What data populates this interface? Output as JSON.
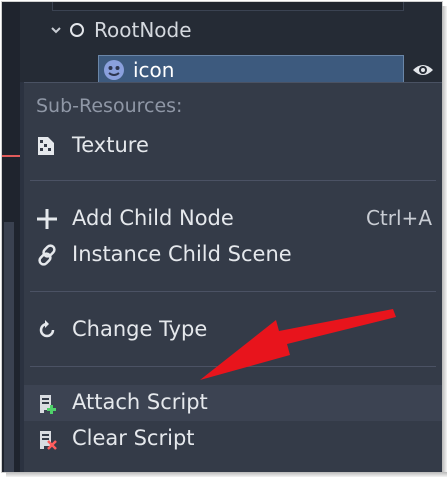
{
  "scene_tree": {
    "root_label": "RootNode",
    "child_label": "icon"
  },
  "context_menu": {
    "section_label": "Sub-Resources:",
    "items": [
      {
        "label": "Texture",
        "icon": "texture-icon",
        "shortcut": ""
      },
      {
        "label": "Add Child Node",
        "icon": "plus-icon",
        "shortcut": "Ctrl+A"
      },
      {
        "label": "Instance Child Scene",
        "icon": "link-icon",
        "shortcut": ""
      },
      {
        "label": "Change Type",
        "icon": "reload-icon",
        "shortcut": ""
      },
      {
        "label": "Attach Script",
        "icon": "script-add-icon",
        "shortcut": ""
      },
      {
        "label": "Clear Script",
        "icon": "script-remove-icon",
        "shortcut": ""
      }
    ]
  },
  "colors": {
    "panel_bg": "#2b3240",
    "menu_bg": "#343b48",
    "selection_bg": "#3d5a7e",
    "annotation_arrow": "#e8141c"
  }
}
